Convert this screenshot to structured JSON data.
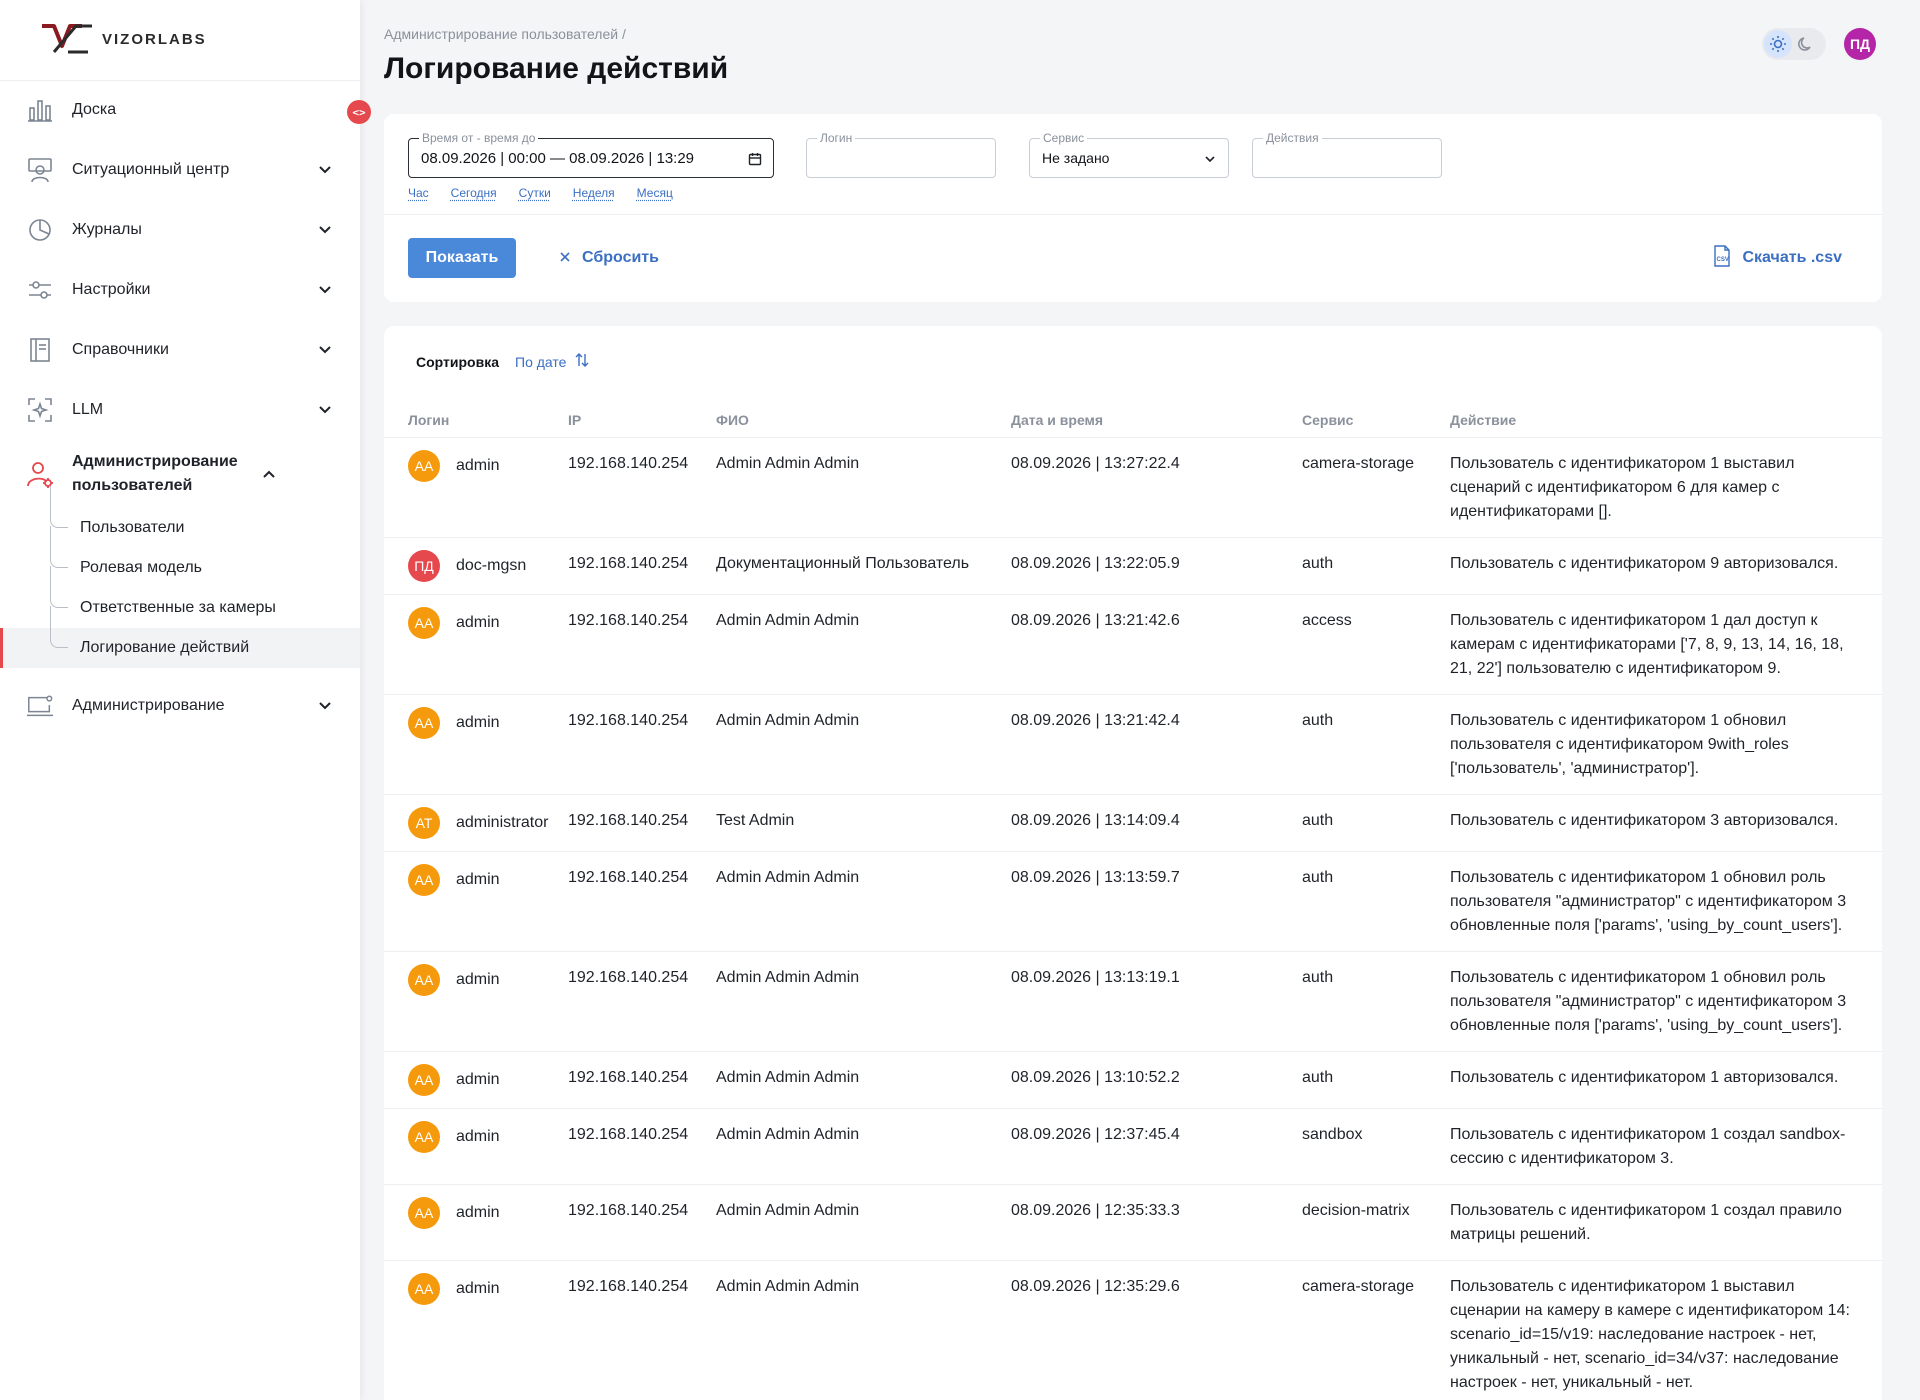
{
  "brand": {
    "logo_text": "VIZORLABS",
    "accent": "#e5484d",
    "primary": "#4a88d9"
  },
  "sidebar": {
    "collapse_glyph": "<>",
    "items": [
      {
        "label": "Доска",
        "icon": "bar-chart-icon",
        "has_chevron": false
      },
      {
        "label": "Ситуационный центр",
        "icon": "operator-icon",
        "has_chevron": true
      },
      {
        "label": "Журналы",
        "icon": "pie-chart-icon",
        "has_chevron": true
      },
      {
        "label": "Настройки",
        "icon": "sliders-icon",
        "has_chevron": true
      },
      {
        "label": "Справочники",
        "icon": "book-icon",
        "has_chevron": true
      },
      {
        "label": "LLM",
        "icon": "ai-frame-icon",
        "has_chevron": true
      }
    ],
    "expanded": {
      "label": "Администрирование пользователей",
      "icon": "user-gear-icon",
      "children": [
        {
          "label": "Пользователи"
        },
        {
          "label": "Ролевая модель"
        },
        {
          "label": "Ответственные за камеры"
        },
        {
          "label": "Логирование действий",
          "active": true
        }
      ]
    },
    "after": [
      {
        "label": "Администрирование",
        "icon": "monitor-gear-icon",
        "has_chevron": true
      }
    ]
  },
  "header": {
    "breadcrumb": "Администрирование пользователей /",
    "title": "Логирование действий",
    "user_initials": "ПД"
  },
  "filters": {
    "date_range": {
      "label": "Время от - время до",
      "value": "08.09.2026 | 00:00 — 08.09.2026 | 13:29"
    },
    "login": {
      "label": "Логин",
      "value": ""
    },
    "service": {
      "label": "Сервис",
      "value": "Не задано"
    },
    "action": {
      "label": "Действия",
      "value": ""
    },
    "quick_ranges": [
      "Час",
      "Сегодня",
      "Сутки",
      "Неделя",
      "Месяц"
    ],
    "show_button": "Показать",
    "reset_button": "Сбросить",
    "csv_button": "Скачать .csv"
  },
  "table": {
    "sort_label": "Сортировка",
    "sort_value": "По дате",
    "columns": [
      "Логин",
      "IP",
      "ФИО",
      "Дата и время",
      "Сервис",
      "Действие"
    ],
    "rows": [
      {
        "initials": "АА",
        "avatar_color": "#f59a0c",
        "login": "admin",
        "ip": "192.168.140.254",
        "fio": "Admin Admin Admin",
        "datetime": "08.09.2026 | 13:27:22.4",
        "service": "camera-storage",
        "action": "Пользователь с идентификатором 1 выставил сценарий с идентификатором 6 для камер с идентификаторами [].",
        "lines": 3
      },
      {
        "initials": "ПД",
        "avatar_color": "#e5484d",
        "login": "doc-mgsn",
        "ip": "192.168.140.254",
        "fio": "Документационный Пользователь",
        "datetime": "08.09.2026 | 13:22:05.9",
        "service": "auth",
        "action": "Пользователь с идентификатором 9 авторизовался.",
        "lines": 1
      },
      {
        "initials": "АА",
        "avatar_color": "#f59a0c",
        "login": "admin",
        "ip": "192.168.140.254",
        "fio": "Admin Admin Admin",
        "datetime": "08.09.2026 | 13:21:42.6",
        "service": "access",
        "action": "Пользователь с идентификатором 1 дал доступ к камерам с идентификаторами ['7, 8, 9, 13, 14, 16, 18, 21, 22'] пользователю с идентификатором 9.",
        "lines": 3
      },
      {
        "initials": "АА",
        "avatar_color": "#f59a0c",
        "login": "admin",
        "ip": "192.168.140.254",
        "fio": "Admin Admin Admin",
        "datetime": "08.09.2026 | 13:21:42.4",
        "service": "auth",
        "action": "Пользователь с идентификатором 1 обновил пользователя с идентификатором 9with_roles ['пользователь', 'администратор'].",
        "lines": 3
      },
      {
        "initials": "АТ",
        "avatar_color": "#f59a0c",
        "login": "administrator",
        "ip": "192.168.140.254",
        "fio": "Test Admin",
        "datetime": "08.09.2026 | 13:14:09.4",
        "service": "auth",
        "action": "Пользователь с идентификатором 3 авторизовался.",
        "lines": 1
      },
      {
        "initials": "АА",
        "avatar_color": "#f59a0c",
        "login": "admin",
        "ip": "192.168.140.254",
        "fio": "Admin Admin Admin",
        "datetime": "08.09.2026 | 13:13:59.7",
        "service": "auth",
        "action": "Пользователь с идентификатором 1 обновил роль пользователя \"администратор\" с идентификатором 3 обновленные поля ['params', 'using_by_count_users'].",
        "lines": 3
      },
      {
        "initials": "АА",
        "avatar_color": "#f59a0c",
        "login": "admin",
        "ip": "192.168.140.254",
        "fio": "Admin Admin Admin",
        "datetime": "08.09.2026 | 13:13:19.1",
        "service": "auth",
        "action": "Пользователь с идентификатором 1 обновил роль пользователя \"администратор\" с идентификатором 3 обновленные поля ['params', 'using_by_count_users'].",
        "lines": 3
      },
      {
        "initials": "АА",
        "avatar_color": "#f59a0c",
        "login": "admin",
        "ip": "192.168.140.254",
        "fio": "Admin Admin Admin",
        "datetime": "08.09.2026 | 13:10:52.2",
        "service": "auth",
        "action": "Пользователь с идентификатором 1 авторизовался.",
        "lines": 1
      },
      {
        "initials": "АА",
        "avatar_color": "#f59a0c",
        "login": "admin",
        "ip": "192.168.140.254",
        "fio": "Admin Admin Admin",
        "datetime": "08.09.2026 | 12:37:45.4",
        "service": "sandbox",
        "action": "Пользователь с идентификатором 1 создал sandbox-сессию с идентификатором 3.",
        "lines": 2
      },
      {
        "initials": "АА",
        "avatar_color": "#f59a0c",
        "login": "admin",
        "ip": "192.168.140.254",
        "fio": "Admin Admin Admin",
        "datetime": "08.09.2026 | 12:35:33.3",
        "service": "decision-matrix",
        "action": "Пользователь с идентификатором 1 создал правило матрицы решений.",
        "lines": 2
      },
      {
        "initials": "АА",
        "avatar_color": "#f59a0c",
        "login": "admin",
        "ip": "192.168.140.254",
        "fio": "Admin Admin Admin",
        "datetime": "08.09.2026 | 12:35:29.6",
        "service": "camera-storage",
        "action": "Пользователь с идентификатором 1 выставил сценарии на камеру в камере с идентификатором 14: scenario_id=15/v19: наследование настроек - нет, уникальный - нет, scenario_id=34/v37: наследование настроек - нет, уникальный - нет.",
        "lines": 5
      }
    ]
  }
}
